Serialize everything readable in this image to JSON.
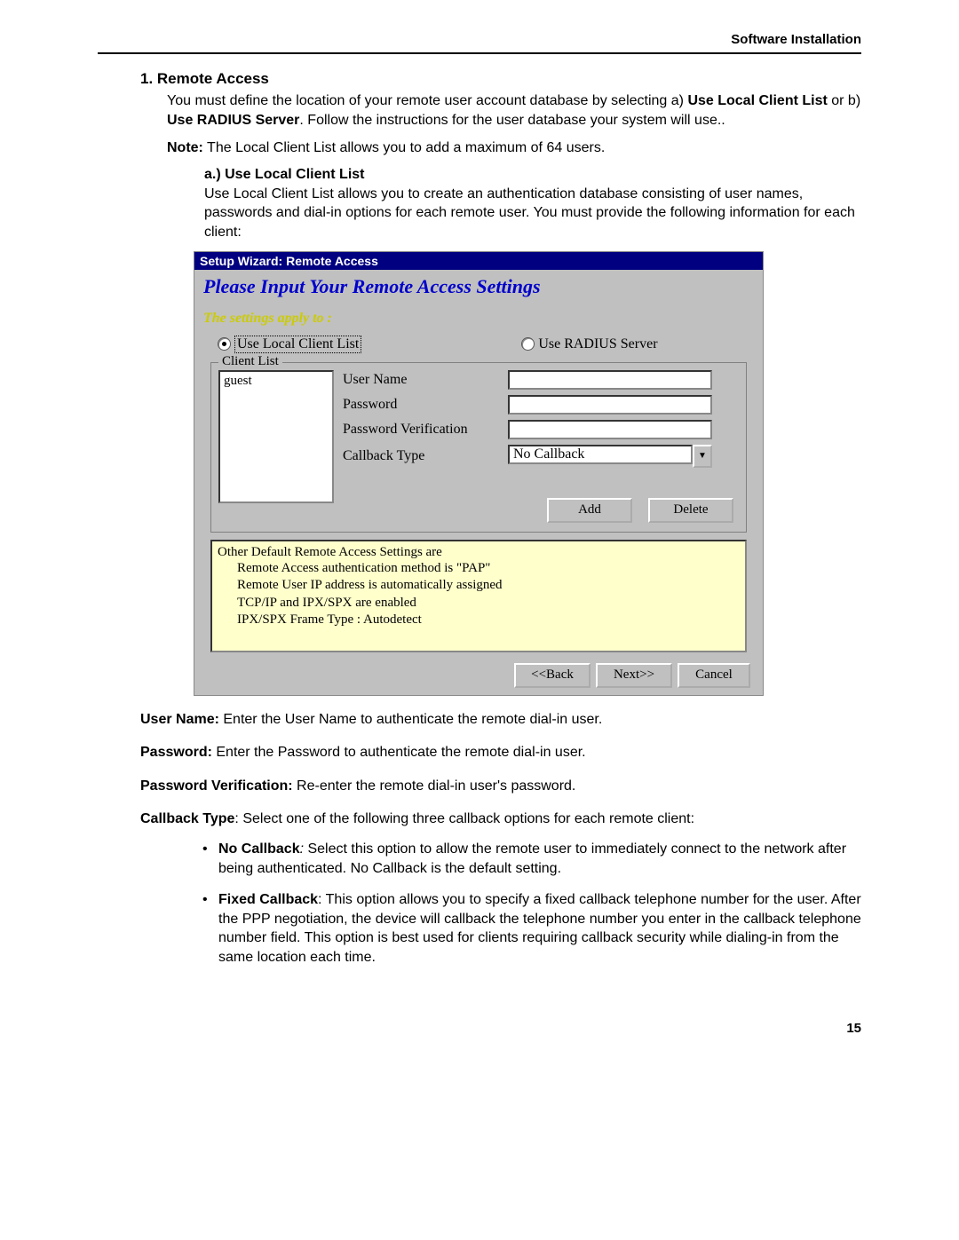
{
  "header": {
    "title": "Software Installation"
  },
  "section": {
    "heading": "1. Remote Access",
    "intro_a": "You must define the location of your remote user account database by selecting a) ",
    "intro_b1": "Use Local Client List",
    "intro_mid": " or b) ",
    "intro_b2": "Use RADIUS Server",
    "intro_c": ".  Follow the instructions for the user database your system will use..",
    "note_label": "Note:",
    "note_text": " The Local Client List allows you to add a maximum of 64 users.",
    "sub_a_heading": "a.) Use Local Client List",
    "sub_a_text": "Use Local Client List allows you to create an authentication database consisting of user names, passwords and dial-in options for each remote user.  You must provide the following information for each client:"
  },
  "dialog": {
    "titlebar": "Setup Wizard: Remote Access",
    "heading": "Please Input Your Remote Access Settings",
    "subheading": "The settings apply to :",
    "radio1": "Use Local Client List",
    "radio2": "Use RADIUS Server",
    "legend": "Client List",
    "list_item": "guest",
    "field_user": "User Name",
    "field_pass": "Password",
    "field_passv": "Password Verification",
    "field_cb": "Callback Type",
    "cb_value": "No Callback",
    "btn_add": "Add",
    "btn_delete": "Delete",
    "info_title": "Other Default Remote Access Settings are",
    "info_l1": "Remote Access authentication method is \"PAP\"",
    "info_l2": "Remote User IP address is automatically assigned",
    "info_l3": "TCP/IP and IPX/SPX are enabled",
    "info_l4": "IPX/SPX Frame Type : Autodetect",
    "nav_back": "<<Back",
    "nav_next": "Next>>",
    "nav_cancel": "Cancel"
  },
  "defs": {
    "uname_label": "User Name:",
    "uname_text": " Enter the User Name to authenticate the remote dial-in user.",
    "pwd_label": "Password:",
    "pwd_text": " Enter the Password to authenticate the remote dial-in user.",
    "pwdv_label": "Password Verification:",
    "pwdv_text": "  Re-enter the remote dial-in user's password.",
    "cb_label": "Callback Type",
    "cb_text": ": Select one of the following three callback options for each remote client:",
    "bullet1_label": "No Callback",
    "bullet1_sep": ": ",
    "bullet1_text": "Select this option to allow the remote user to immediately connect to the network after being authenticated. No Callback is the default setting.",
    "bullet2_label": "Fixed Callback",
    "bullet2_text": ": This option allows you to specify a fixed callback telephone number for the user.  After the PPP negotiation, the device will callback the telephone number you enter in the callback telephone number field.  This option is best used for clients requiring callback security while dialing-in from the same location each time."
  },
  "page_number": "15"
}
